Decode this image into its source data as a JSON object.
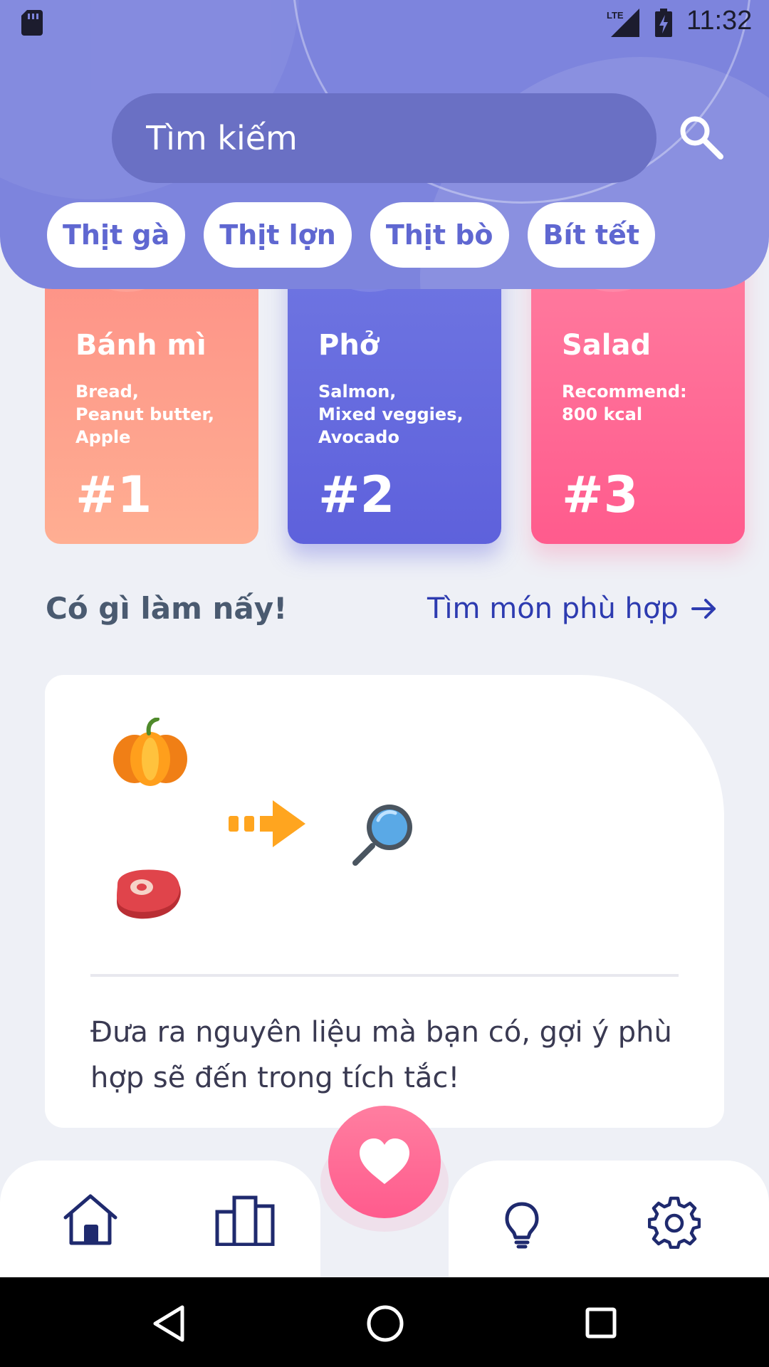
{
  "status_bar": {
    "time": "11:32",
    "network": "LTE"
  },
  "search": {
    "placeholder": "Tìm kiếm"
  },
  "chips": [
    {
      "label": "Thịt gà"
    },
    {
      "label": "Thịt lợn"
    },
    {
      "label": "Thịt bò"
    },
    {
      "label": "Bít tết"
    }
  ],
  "cards": [
    {
      "title": "Bánh mì",
      "desc": "Bread,\nPeanut butter,\nApple",
      "rank": "#1"
    },
    {
      "title": "Phở",
      "desc": "Salmon,\nMixed veggies,\nAvocado",
      "rank": "#2"
    },
    {
      "title": "Salad",
      "desc": "Recommend:\n800 kcal",
      "rank": "#3"
    }
  ],
  "section": {
    "title": "Có gì làm nấy!",
    "link": "Tìm món phù hợp"
  },
  "ingredient_card": {
    "text": "Đưa ra nguyên liệu mà bạn có, gợi ý phù hợp sẽ đến trong tích tắc!"
  },
  "colors": {
    "header": "#7d84dd",
    "accent": "#ff5b8d",
    "nav_icon": "#1f2a6e",
    "link": "#2d3bb0"
  },
  "icons": {
    "nav": [
      "home-icon",
      "leaderboard-icon",
      "heart-icon",
      "bulb-icon",
      "gear-icon"
    ],
    "system": [
      "back-icon",
      "home-circle-icon",
      "recents-icon"
    ]
  }
}
